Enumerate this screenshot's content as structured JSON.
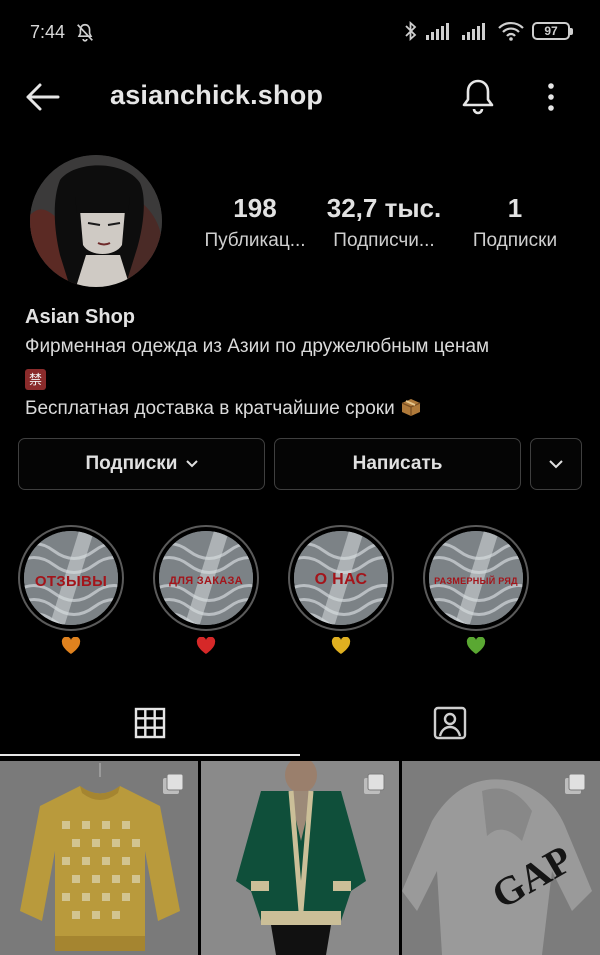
{
  "status_bar": {
    "time": "7:44",
    "battery": "97"
  },
  "header": {
    "username": "asianchick.shop"
  },
  "stats": [
    {
      "value": "198",
      "label": "Публикац..."
    },
    {
      "value": "32,7 тыс.",
      "label": "Подписчи..."
    },
    {
      "value": "1",
      "label": "Подписки"
    }
  ],
  "bio": {
    "name": "Asian Shop",
    "line1": "Фирменная одежда из Азии по дружелюбным ценам",
    "line2_emoji": "禁",
    "line3": "Бесплатная доставка в кратчайшие сроки"
  },
  "actions": {
    "following_label": "Подписки",
    "message_label": "Написать"
  },
  "highlights": [
    {
      "title": "ОТЗЫВЫ",
      "heart_color": "#e0821e"
    },
    {
      "title": "ДЛЯ ЗАКАЗА",
      "heart_color": "#d62828"
    },
    {
      "title": "О НАС",
      "heart_color": "#e0b020"
    },
    {
      "title": "РАЗМЕРНЫЙ РЯД",
      "heart_color": "#5aa832"
    }
  ],
  "colors": {
    "background": "#000000",
    "text": "#e6e6e6",
    "button_border": "#3f3f3f",
    "highlight_text": "#a3141a"
  },
  "icons": [
    "back-arrow-icon",
    "bell-icon",
    "more-vertical-icon",
    "grid-icon",
    "tagged-icon",
    "multiple-posts-icon"
  ]
}
